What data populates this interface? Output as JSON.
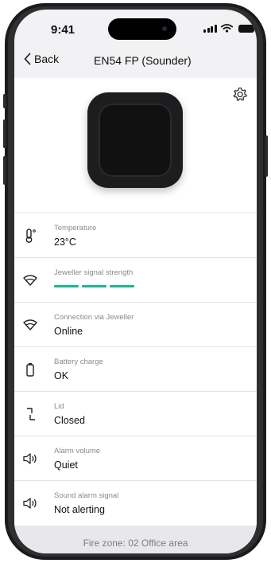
{
  "status_bar": {
    "time": "9:41"
  },
  "nav": {
    "back_label": "Back",
    "title": "EN54 FP (Sounder)"
  },
  "hero": {
    "settings_icon": "gear-icon",
    "device_image": "en54-fp-sounder-device"
  },
  "rows": [
    {
      "icon": "thermometer-icon",
      "label": "Temperature",
      "value": "23°C"
    },
    {
      "icon": "jeweller-signal-icon",
      "label": "Jeweller signal strength",
      "signal_bars": 3
    },
    {
      "icon": "jeweller-connection-icon",
      "label": "Connection via Jeweller",
      "value": "Online"
    },
    {
      "icon": "battery-icon",
      "label": "Battery charge",
      "value": "OK"
    },
    {
      "icon": "lid-icon",
      "label": "Lid",
      "value": "Closed"
    },
    {
      "icon": "speaker-icon",
      "label": "Alarm volume",
      "value": "Quiet"
    },
    {
      "icon": "speaker-icon",
      "label": "Sound alarm signal",
      "value": "Not alerting"
    }
  ],
  "footer": {
    "text": "Fire zone: 02 Office area"
  },
  "colors": {
    "signal_bar": "#1cb890",
    "background": "#f2f2f4"
  }
}
